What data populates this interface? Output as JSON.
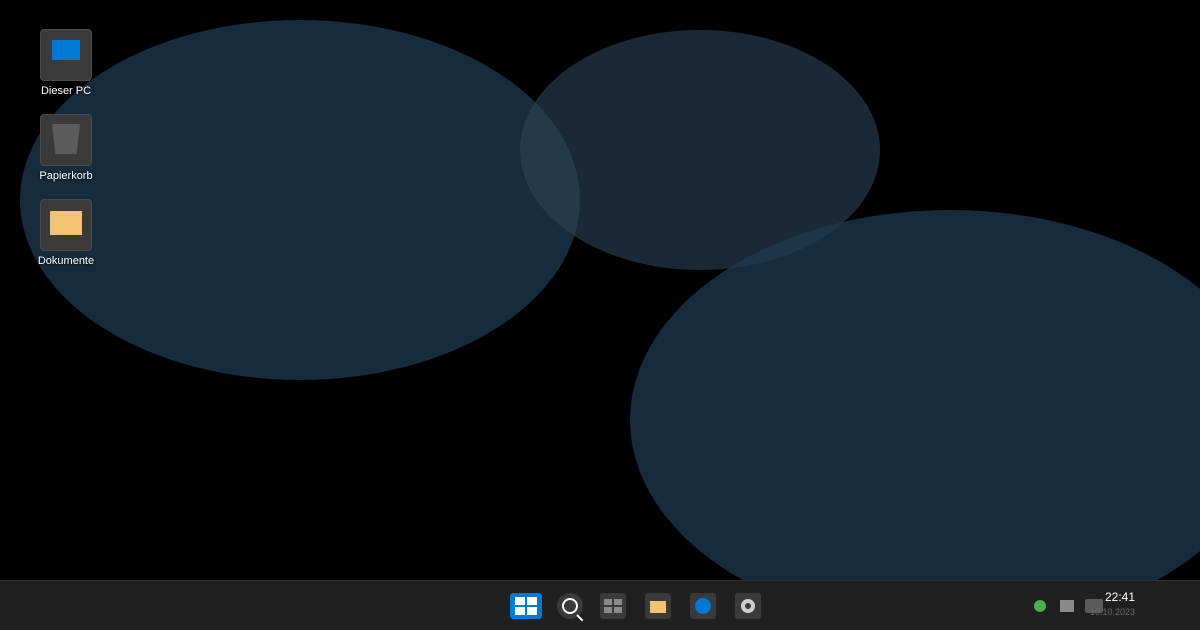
{
  "desktop": {
    "icons": [
      {
        "label": "Dieser PC",
        "icon": "computer-icon"
      },
      {
        "label": "Papierkorb",
        "icon": "recycle-bin-icon"
      },
      {
        "label": "Dokumente",
        "icon": "folder-icon"
      }
    ]
  },
  "taskbar": {
    "apps": [
      {
        "icon": "start-icon"
      },
      {
        "icon": "search-icon"
      },
      {
        "icon": "task-view-icon"
      },
      {
        "icon": "file-explorer-icon"
      },
      {
        "icon": "browser-icon"
      },
      {
        "icon": "settings-icon"
      }
    ],
    "tray": {
      "icons": [
        "status-dot-icon",
        "tray-square-icon",
        "tray-battery-icon"
      ],
      "status_color": "#4caf50"
    },
    "clock": {
      "time": "22:41",
      "date": "10.10.2023"
    }
  },
  "colors": {
    "accent": "#0078d4",
    "taskbar_bg": "#202020",
    "desktop_bg": "#000000",
    "folder": "#f3c46f",
    "wallpaper_shape": "#1e3a4f"
  }
}
